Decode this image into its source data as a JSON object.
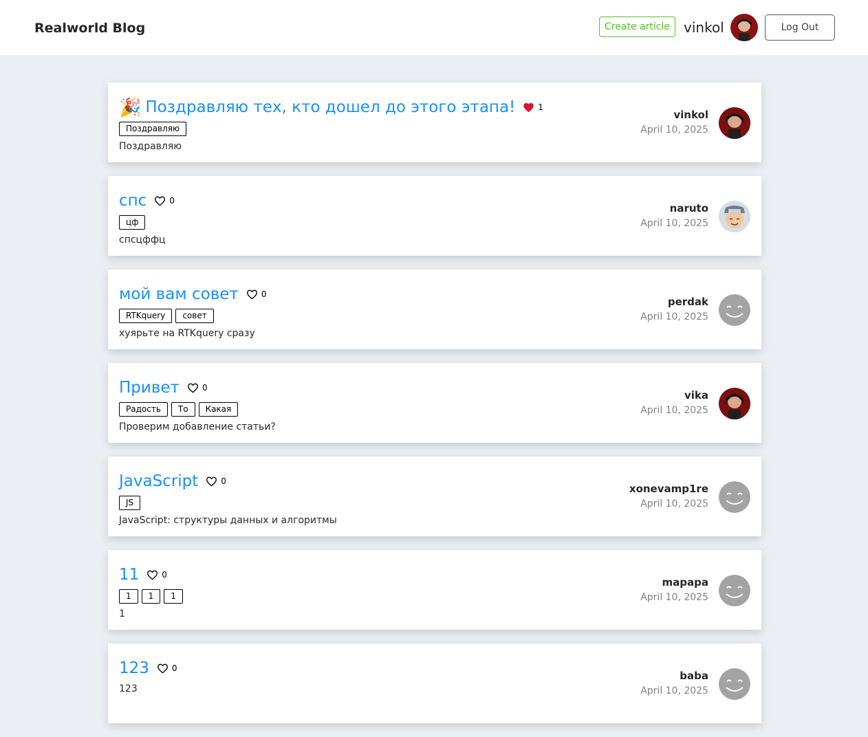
{
  "header": {
    "brand": "Realworld Blog",
    "create_label": "Create article",
    "username": "vinkol",
    "logout_label": "Log Out"
  },
  "articles": [
    {
      "emoji": "🎉",
      "title": "Поздравляю тех, кто дошел до этого этапа!",
      "liked": true,
      "likes": "1",
      "tags": [
        "Поздравляю"
      ],
      "description": "Поздравляю",
      "author": "vinkol",
      "date": "April 10, 2025",
      "avatar": "dark-red"
    },
    {
      "emoji": "",
      "title": "спс",
      "liked": false,
      "likes": "0",
      "tags": [
        "цф"
      ],
      "description": "спсцффц",
      "author": "naruto",
      "date": "April 10, 2025",
      "avatar": "naruto"
    },
    {
      "emoji": "",
      "title": "мой вам совет",
      "liked": false,
      "likes": "0",
      "tags": [
        "RTKquery",
        "совет"
      ],
      "description": "хуярьте на RTKquery сразу",
      "author": "perdak",
      "date": "April 10, 2025",
      "avatar": "smiley"
    },
    {
      "emoji": "",
      "title": "Привет",
      "liked": false,
      "likes": "0",
      "tags": [
        "Радость",
        "То",
        "Какая"
      ],
      "description": "Проверим добавление статьи?",
      "author": "vika",
      "date": "April 10, 2025",
      "avatar": "dark-red"
    },
    {
      "emoji": "",
      "title": "JavaScript",
      "liked": false,
      "likes": "0",
      "tags": [
        "JS"
      ],
      "description": "JavaScript: структуры данных и алгоритмы",
      "author": "xonevamp1re",
      "date": "April 10, 2025",
      "avatar": "smiley"
    },
    {
      "emoji": "",
      "title": "11",
      "liked": false,
      "likes": "0",
      "tags": [
        "1",
        "1",
        "1"
      ],
      "description": "1",
      "author": "mapapa",
      "date": "April 10, 2025",
      "avatar": "smiley"
    },
    {
      "emoji": "",
      "title": "123",
      "liked": false,
      "likes": "0",
      "tags": [],
      "description": "123",
      "author": "baba",
      "date": "April 10, 2025",
      "avatar": "smiley"
    }
  ],
  "colors": {
    "title": "#1890ff",
    "create": "#52c41a",
    "liked": "#e5102e"
  }
}
